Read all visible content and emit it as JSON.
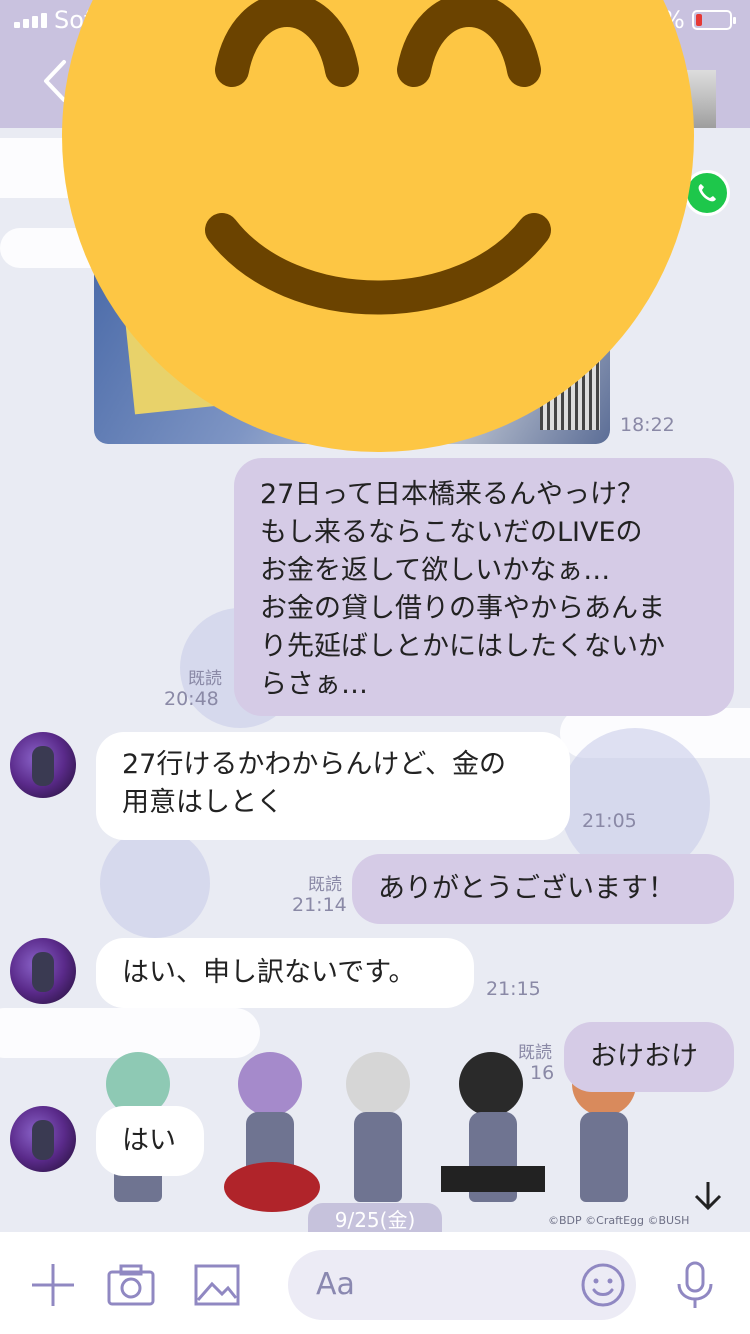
{
  "status_bar": {
    "carrier": "Sof",
    "battery_percent": "%"
  },
  "header": {
    "back_icon": "chevron-left-icon",
    "call_icon": "phone-icon"
  },
  "messages": [
    {
      "type": "image",
      "direction": "in",
      "time": "18:22"
    },
    {
      "type": "text",
      "direction": "out",
      "read": "既読",
      "time": "20:48",
      "lines": [
        "27日って日本橋来るんやっけ？",
        "もし来るならこないだのLIVEの",
        "お金を返して欲しいかなぁ…",
        "お金の貸し借りの事やからあんま",
        "り先延ばしとかにはしたくないか",
        "らさぁ…"
      ]
    },
    {
      "type": "text",
      "direction": "in",
      "time": "21:05",
      "lines": [
        "27行けるかわからんけど、金の",
        "用意はしとく"
      ]
    },
    {
      "type": "text",
      "direction": "out",
      "read": "既読",
      "time": "21:14",
      "lines": [
        "ありがとうございます！"
      ]
    },
    {
      "type": "text",
      "direction": "in",
      "time": "21:15",
      "lines": [
        "はい、申し訳ないです。"
      ]
    },
    {
      "type": "text",
      "direction": "out",
      "read": "既読",
      "time": "16",
      "lines": [
        "おけおけ"
      ]
    },
    {
      "type": "text",
      "direction": "in",
      "lines": [
        "はい"
      ]
    }
  ],
  "sticker_copyright": "©BDP ©CraftEgg ©BUSH",
  "date_chip": "9/25(金)",
  "composer": {
    "placeholder": "Aa",
    "icons": [
      "plus-icon",
      "camera-icon",
      "image-icon",
      "emoji-icon",
      "microphone-icon"
    ]
  },
  "colors": {
    "header_bg": "#c9c2df",
    "out_bubble": "#d5cbe6",
    "in_bubble": "#ffffff",
    "smiley": "#fdc644",
    "smiley_features": "#6b4300",
    "call_green": "#1ec74b",
    "accent_purple": "#9088c2"
  }
}
